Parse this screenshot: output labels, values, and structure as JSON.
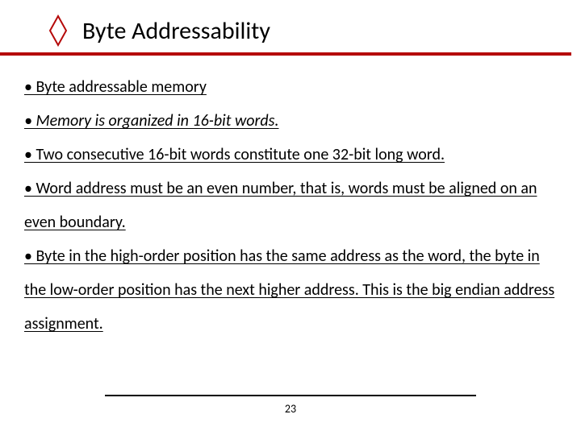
{
  "header": {
    "icon": "diamond-icon",
    "title": "Byte Addressability"
  },
  "bullets": [
    "• Byte addressable memory",
    "• Memory is organized in 16-bit words.",
    "• Two consecutive 16-bit words constitute one 32-bit long word.",
    "• Word address must be an even number, that is, words must be aligned on an even boundary.",
    "• Byte in the high-order position has the same address as the word, the byte in  the low-order position has the next  higher address. This is the big endian  address assignment."
  ],
  "italic_index": 1,
  "page_number": "23"
}
